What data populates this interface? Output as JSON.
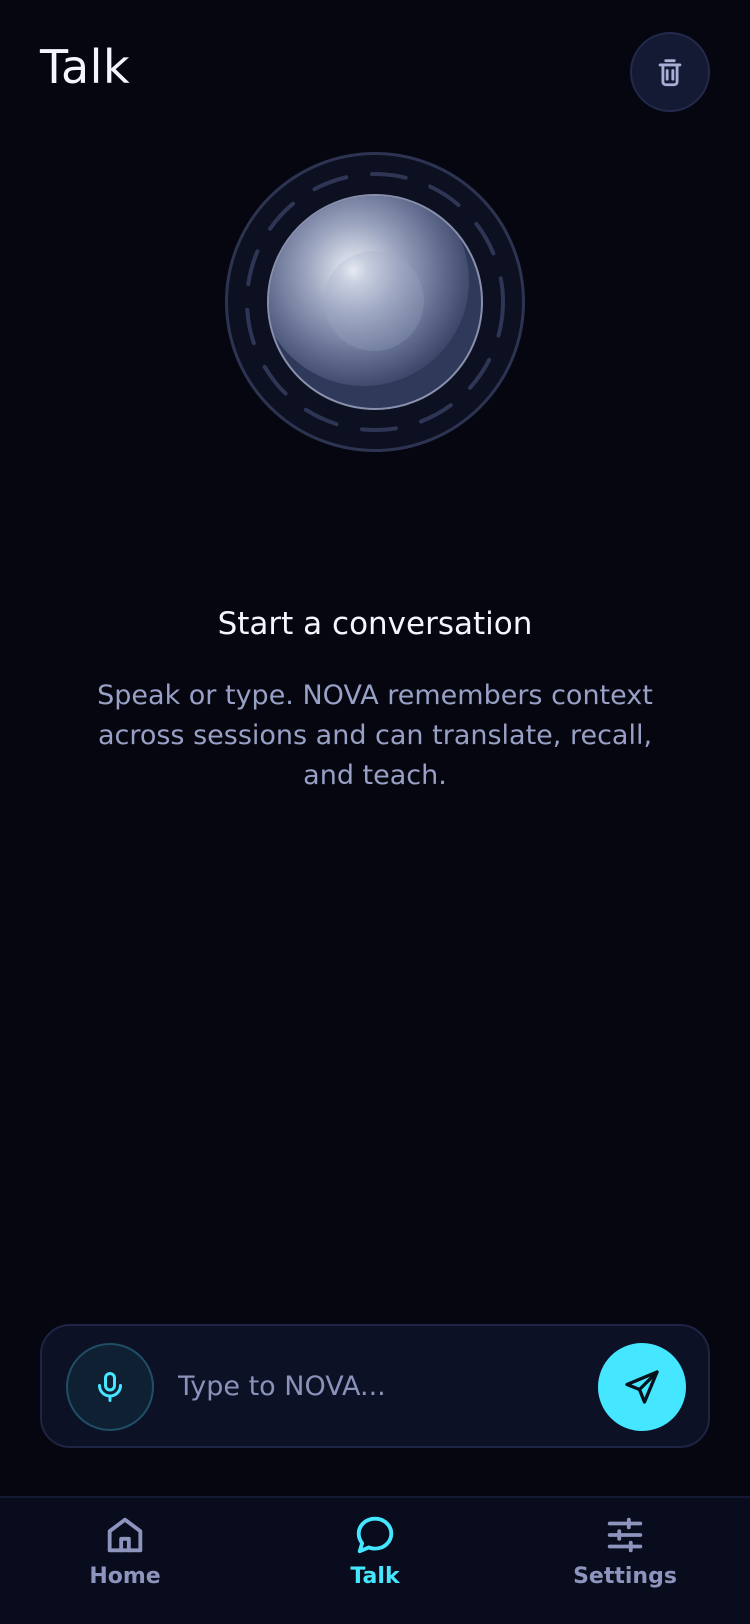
{
  "header": {
    "title": "Talk",
    "clear_icon": "trash-icon"
  },
  "orb": {
    "icon": "voice-orb"
  },
  "empty_state": {
    "title": "Start a conversation",
    "description": "Speak or type. NOVA remembers context across sessions and can translate, recall, and teach."
  },
  "composer": {
    "mic_icon": "microphone-icon",
    "placeholder": "Type to NOVA...",
    "value": "",
    "send_icon": "send-icon"
  },
  "tabbar": {
    "items": [
      {
        "label": "Home",
        "icon": "home-icon",
        "active": false
      },
      {
        "label": "Talk",
        "icon": "chat-bubble-icon",
        "active": true
      },
      {
        "label": "Settings",
        "icon": "sliders-icon",
        "active": false
      }
    ]
  },
  "colors": {
    "background": "#05060f",
    "accent": "#45e6ff",
    "muted_text": "#98a0c6",
    "inactive_tab": "#8d94bd"
  }
}
